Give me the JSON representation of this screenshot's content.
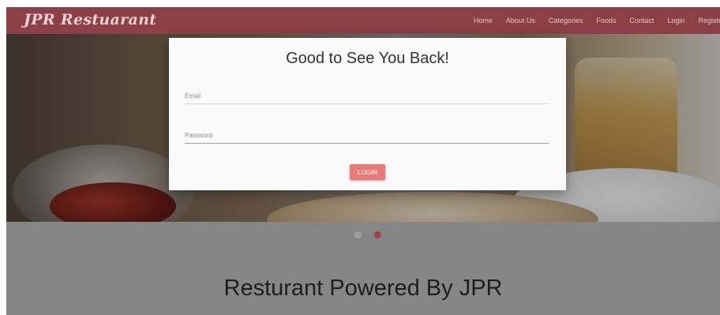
{
  "navbar": {
    "brand": "JPR Restuarant",
    "links": [
      "Home",
      "About Us",
      "Categories",
      "Foods",
      "Contact",
      "Login",
      "Register"
    ]
  },
  "login_modal": {
    "title": "Good to See You Back!",
    "email_placeholder": "Email",
    "password_placeholder": "Password",
    "submit_label": "LOGIN"
  },
  "carousel": {
    "slide_count": 2,
    "active_index": 1
  },
  "tagline": "Resturant Powered By JPR",
  "colors": {
    "navbar_bg": "#8a4046",
    "button_bg": "#e97a7a",
    "active_dot": "#a93f45",
    "page_bg": "#868686"
  }
}
